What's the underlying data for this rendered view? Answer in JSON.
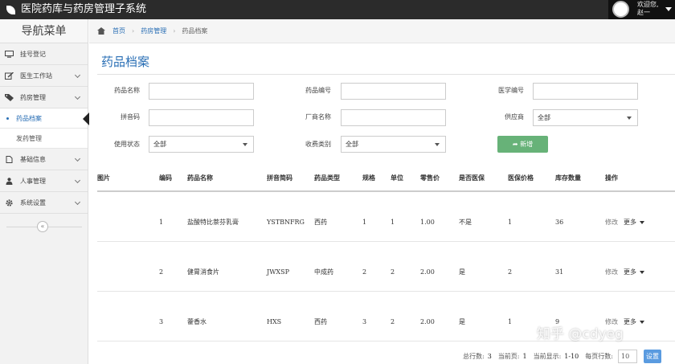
{
  "app": {
    "title": "医院药库与药房管理子系统"
  },
  "user": {
    "welcome": "欢迎您,",
    "name": "赵一"
  },
  "sidebar": {
    "title": "导航菜单",
    "items": [
      {
        "label": "挂号登记",
        "icon": "monitor-icon"
      },
      {
        "label": "医生工作站",
        "icon": "edit-icon"
      },
      {
        "label": "药房管理",
        "icon": "tag-icon"
      },
      {
        "label": "基础信息",
        "icon": "document-icon"
      },
      {
        "label": "人事管理",
        "icon": "person-icon"
      },
      {
        "label": "系统设置",
        "icon": "gear-icon"
      }
    ],
    "subitems": [
      {
        "label": "药品档案"
      },
      {
        "label": "发药管理"
      }
    ],
    "collapse_symbol": "«"
  },
  "breadcrumb": {
    "home": "首页",
    "section": "药房管理",
    "current": "药品档案"
  },
  "page": {
    "title": "药品档案"
  },
  "filters": {
    "drug_name_label": "药品名称",
    "drug_name_value": "",
    "drug_code_label": "药品编号",
    "drug_code_value": "",
    "med_code_label": "医学编号",
    "med_code_value": "",
    "pinyin_label": "拼音码",
    "pinyin_value": "",
    "maker_label": "厂商名称",
    "maker_value": "",
    "supplier_label": "供应商",
    "supplier_value": "全部",
    "status_label": "使用状态",
    "status_value": "全部",
    "fee_label": "收费类别",
    "fee_value": "全部",
    "add_button": "新增"
  },
  "table": {
    "headers": [
      "图片",
      "编码",
      "药品名称",
      "拼音简码",
      "药品类型",
      "规格",
      "单位",
      "零售价",
      "是否医保",
      "医保价格",
      "库存数量",
      "操作"
    ],
    "rows": [
      {
        "code": "1",
        "name": "盐酸特比萘芬乳膏",
        "pinyin": "YSTBNFRG",
        "type": "西药",
        "spec": "1",
        "unit": "1",
        "price": "1.00",
        "insured": "不是",
        "ins_price": "1",
        "stock": "36",
        "edit": "修改",
        "more": "更多"
      },
      {
        "code": "2",
        "name": "健胃消食片",
        "pinyin": "JWXSP",
        "type": "中成药",
        "spec": "2",
        "unit": "2",
        "price": "2.00",
        "insured": "是",
        "ins_price": "2",
        "stock": "31",
        "edit": "修改",
        "more": "更多"
      },
      {
        "code": "3",
        "name": "藿香水",
        "pinyin": "HXS",
        "type": "西药",
        "spec": "3",
        "unit": "2",
        "price": "2.00",
        "insured": "是",
        "ins_price": "1",
        "stock": "9",
        "edit": "修改",
        "more": "更多"
      }
    ]
  },
  "pagination": {
    "total_label": "总行数:",
    "total": "3",
    "current_label": "当前页:",
    "current": "1",
    "showing_label": "当前显示:",
    "showing": "1-10",
    "per_page_label": "每页行数:",
    "per_page": "10",
    "go_button": "设置"
  },
  "watermark": "知乎 @cdyeg",
  "colors": {
    "accent": "#2a6fb5",
    "topbar": "#2b2b2b",
    "add_button": "#67b278",
    "go_button": "#5a9be0"
  }
}
